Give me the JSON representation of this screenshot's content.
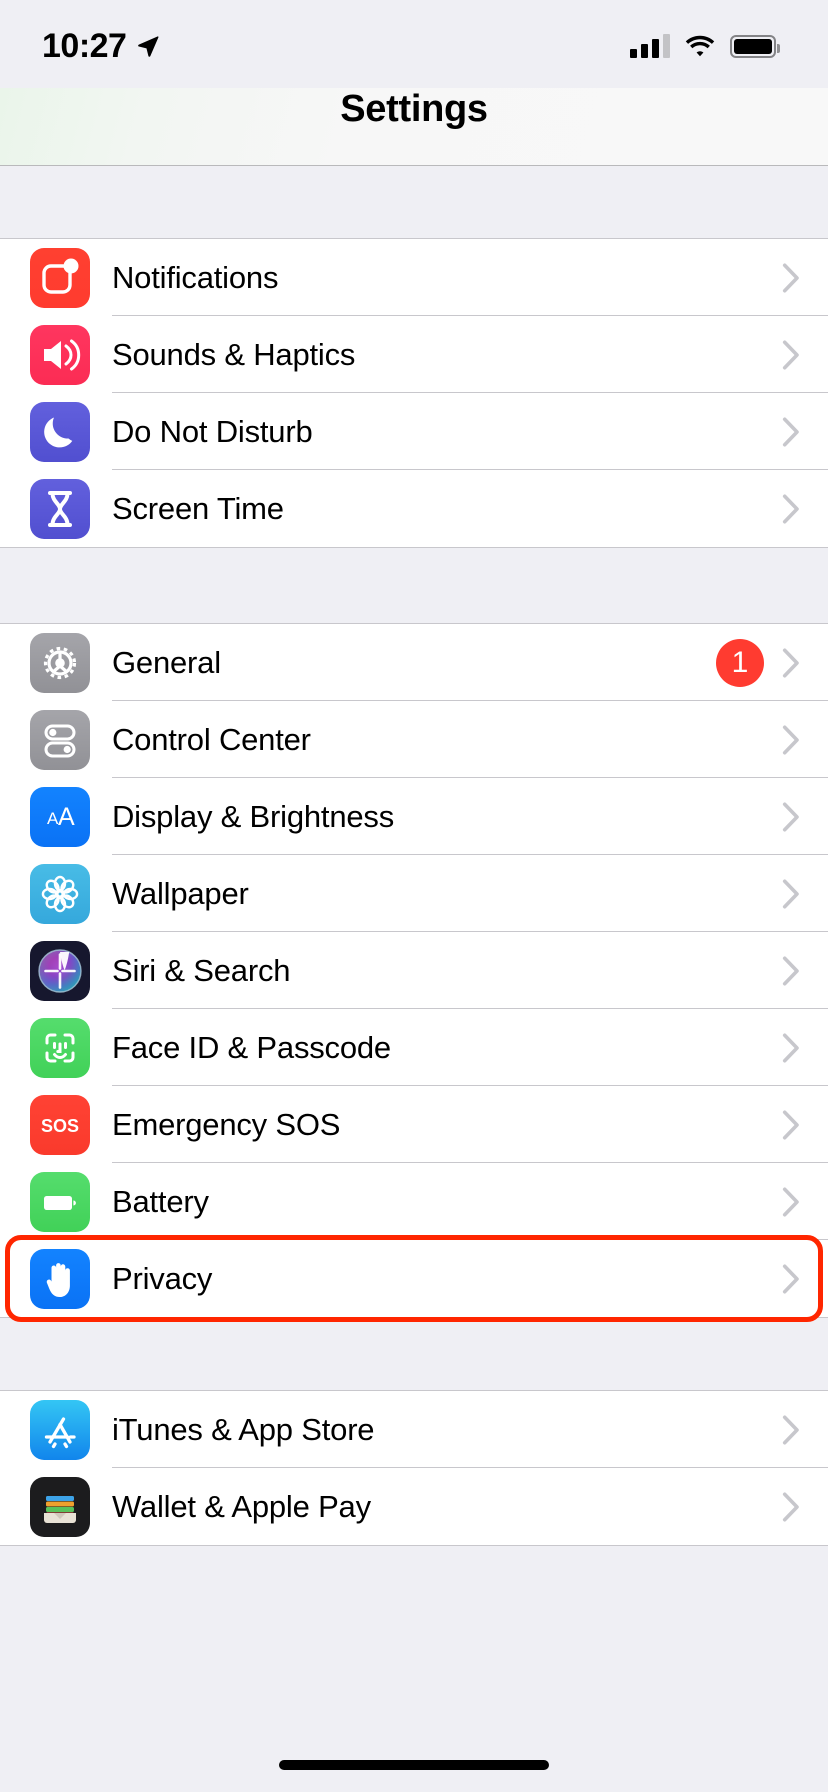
{
  "status_bar": {
    "time": "10:27",
    "location_icon": "location-arrow-icon",
    "signal_icon": "cellular-signal-icon",
    "wifi_icon": "wifi-icon",
    "battery_icon": "battery-icon"
  },
  "header": {
    "title": "Settings"
  },
  "colors": {
    "accent_blue": "#007AFF",
    "badge_red": "#FF3B30",
    "annotation_red": "#FF2600",
    "group_background": "#EFEFF4",
    "row_background": "#FFFFFF",
    "separator": "#C8C7CC"
  },
  "annotation": {
    "target": "Privacy",
    "shape": "rounded-rectangle",
    "color": "#FF2600"
  },
  "groups": [
    {
      "id": "group-alerts",
      "rows": [
        {
          "label": "Notifications",
          "icon": "notifications-icon",
          "icon_color": "#FF3B30",
          "chevron": true,
          "badge": null
        },
        {
          "label": "Sounds & Haptics",
          "icon": "sounds-haptics-icon",
          "icon_color": "#FF2D55",
          "chevron": true,
          "badge": null
        },
        {
          "label": "Do Not Disturb",
          "icon": "do-not-disturb-moon-icon",
          "icon_color": "#5856D6",
          "chevron": true,
          "badge": null
        },
        {
          "label": "Screen Time",
          "icon": "screen-time-hourglass-icon",
          "icon_color": "#5856D6",
          "chevron": true,
          "badge": null
        }
      ]
    },
    {
      "id": "group-system",
      "rows": [
        {
          "label": "General",
          "icon": "general-gear-icon",
          "icon_color": "#8E8E93",
          "chevron": true,
          "badge": "1"
        },
        {
          "label": "Control Center",
          "icon": "control-center-toggles-icon",
          "icon_color": "#8E8E93",
          "chevron": true,
          "badge": null
        },
        {
          "label": "Display & Brightness",
          "icon": "display-brightness-aa-icon",
          "icon_color": "#007AFF",
          "chevron": true,
          "badge": null
        },
        {
          "label": "Wallpaper",
          "icon": "wallpaper-flower-icon",
          "icon_color": "#3BAFDA",
          "chevron": true,
          "badge": null
        },
        {
          "label": "Siri & Search",
          "icon": "siri-search-icon",
          "icon_color": "#1B1C3A",
          "chevron": true,
          "badge": null
        },
        {
          "label": "Face ID & Passcode",
          "icon": "face-id-icon",
          "icon_color": "#4CD964",
          "chevron": true,
          "badge": null
        },
        {
          "label": "Emergency SOS",
          "icon": "emergency-sos-icon",
          "icon_color": "#FF3B30",
          "chevron": true,
          "badge": null
        },
        {
          "label": "Battery",
          "icon": "battery-icon",
          "icon_color": "#4CD964",
          "chevron": true,
          "badge": null
        },
        {
          "label": "Privacy",
          "icon": "privacy-hand-icon",
          "icon_color": "#007AFF",
          "chevron": true,
          "badge": null
        }
      ]
    },
    {
      "id": "group-stores",
      "rows": [
        {
          "label": "iTunes & App Store",
          "icon": "app-store-icon",
          "icon_color": "#1B9CF0",
          "chevron": true,
          "badge": null
        },
        {
          "label": "Wallet & Apple Pay",
          "icon": "wallet-icon",
          "icon_color": "#1C1C1E",
          "chevron": true,
          "badge": null
        }
      ]
    }
  ]
}
